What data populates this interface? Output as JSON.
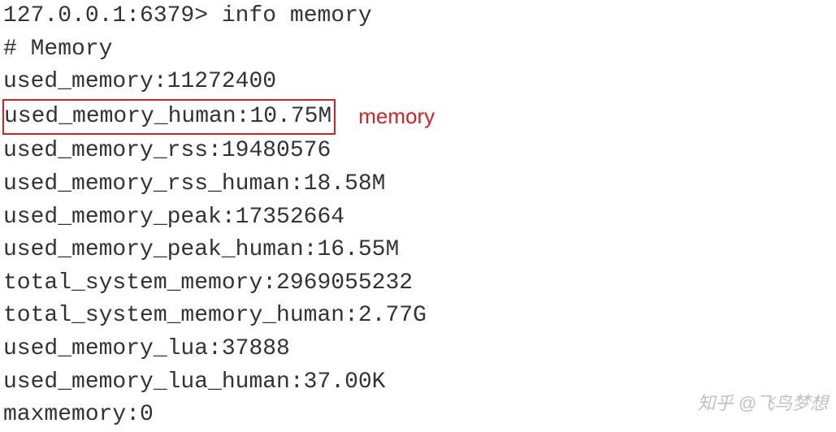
{
  "prompt": {
    "host": "127.0.0.1:6379",
    "symbol": ">",
    "command": "info memory"
  },
  "section_header": "# Memory",
  "metrics": {
    "used_memory": "used_memory:11272400",
    "used_memory_human": "used_memory_human:10.75M",
    "used_memory_rss": "used_memory_rss:19480576",
    "used_memory_rss_human": "used_memory_rss_human:18.58M",
    "used_memory_peak": "used_memory_peak:17352664",
    "used_memory_peak_human": "used_memory_peak_human:16.55M",
    "total_system_memory": "total_system_memory:2969055232",
    "total_system_memory_human": "total_system_memory_human:2.77G",
    "used_memory_lua": "used_memory_lua:37888",
    "used_memory_lua_human": "used_memory_lua_human:37.00K",
    "maxmemory": "maxmemory:0"
  },
  "annotation": "memory",
  "watermark": "知乎 @飞鸟梦想"
}
